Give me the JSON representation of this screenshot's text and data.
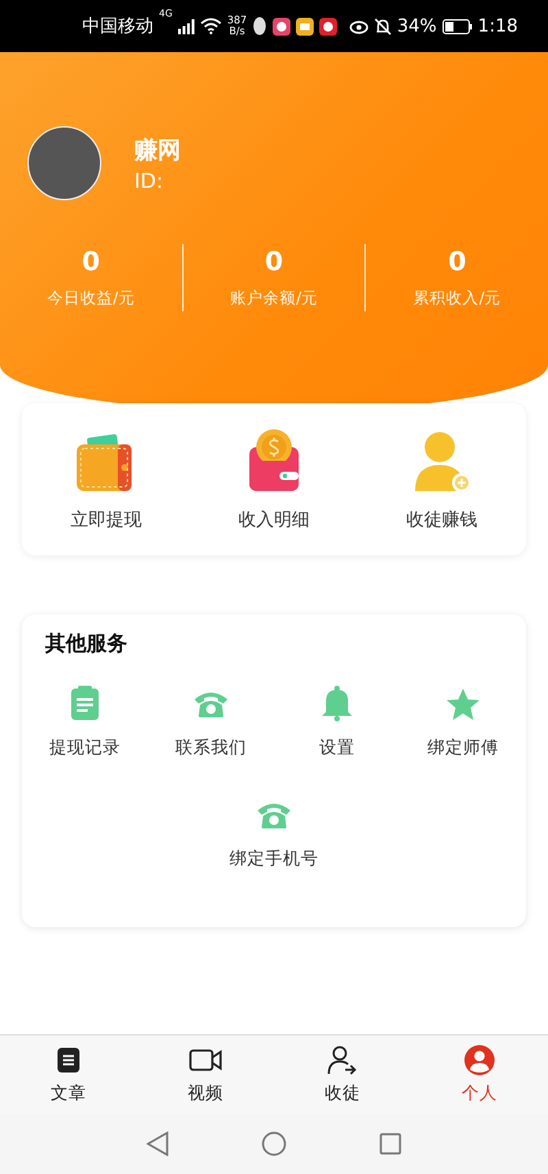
{
  "status_bar": {
    "carrier": "中国移动",
    "network": "4G",
    "speed_value": "387",
    "speed_unit": "B/s",
    "battery": "34%",
    "time": "1:18"
  },
  "profile": {
    "name": "赚网",
    "id_label": "ID:"
  },
  "stats": [
    {
      "value": "0",
      "label": "今日收益/元"
    },
    {
      "value": "0",
      "label": "账户余额/元"
    },
    {
      "value": "0",
      "label": "累积收入/元"
    }
  ],
  "quick_actions": [
    {
      "kind": "wallet",
      "label": "立即提现"
    },
    {
      "kind": "purse",
      "label": "收入明细"
    },
    {
      "kind": "invite",
      "label": "收徒赚钱"
    }
  ],
  "services": {
    "title": "其他服务",
    "items": [
      {
        "kind": "notes",
        "label": "提现记录"
      },
      {
        "kind": "phone",
        "label": "联系我们"
      },
      {
        "kind": "bell",
        "label": "设置"
      },
      {
        "kind": "star",
        "label": "绑定师傅"
      },
      {
        "kind": "phone",
        "label": "绑定手机号"
      }
    ]
  },
  "tabs": [
    {
      "kind": "article",
      "label": "文章",
      "selected": false
    },
    {
      "kind": "video",
      "label": "视频",
      "selected": false
    },
    {
      "kind": "invite",
      "label": "收徒",
      "selected": false
    },
    {
      "kind": "person",
      "label": "个人",
      "selected": true
    }
  ]
}
